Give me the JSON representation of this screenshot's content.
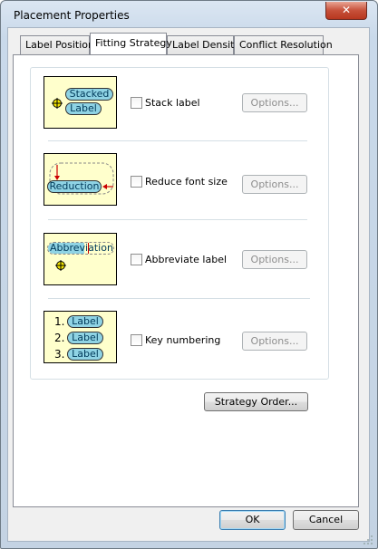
{
  "window": {
    "title": "Placement Properties",
    "close_symbol": "✕"
  },
  "tabs": [
    {
      "label": "Label Position",
      "active": false
    },
    {
      "label": "Fitting Strategy",
      "active": true
    },
    {
      "label": "Label Density",
      "active": false
    },
    {
      "label": "Conflict Resolution",
      "active": false
    }
  ],
  "strategies": [
    {
      "label": "Stack label",
      "checked": false,
      "options_label": "Options...",
      "preview": {
        "texts": [
          "Stacked",
          "Label"
        ]
      }
    },
    {
      "label": "Reduce font size",
      "checked": false,
      "options_label": "Options...",
      "preview": {
        "texts": [
          "Reduction"
        ]
      }
    },
    {
      "label": "Abbreviate label",
      "checked": false,
      "options_label": "Options...",
      "preview": {
        "texts": [
          "Abbreviation"
        ]
      }
    },
    {
      "label": "Key numbering",
      "checked": false,
      "options_label": "Options...",
      "preview": {
        "numbers": [
          "1.",
          "2.",
          "3."
        ],
        "texts": [
          "Label",
          "Label",
          "Label"
        ]
      }
    }
  ],
  "buttons": {
    "strategy_order": "Strategy Order...",
    "ok": "OK",
    "cancel": "Cancel"
  },
  "colors": {
    "preview_bg": "#ffffcc",
    "pill_fill": "#8fd3e4",
    "arrow_red": "#cc0000",
    "anchor_yellow": "#f5e600"
  }
}
